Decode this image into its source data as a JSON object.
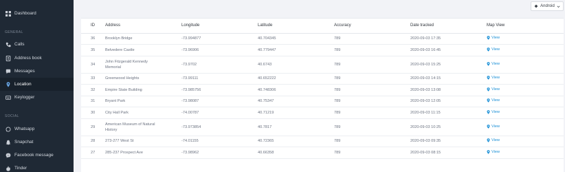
{
  "sidebar": {
    "dashboard": "Dashboard",
    "section_general": "GENERAL",
    "items": [
      {
        "label": "Calls",
        "icon": "phone-icon"
      },
      {
        "label": "Address book",
        "icon": "address-book-icon"
      },
      {
        "label": "Messages",
        "icon": "messages-icon"
      },
      {
        "label": "Location",
        "icon": "location-pin-icon"
      },
      {
        "label": "Keylogger",
        "icon": "keyboard-icon"
      }
    ],
    "section_social": "SOCIAL",
    "social_items": [
      {
        "label": "Whatsapp",
        "icon": "whatsapp-icon"
      },
      {
        "label": "Snapchat",
        "icon": "snapchat-icon"
      },
      {
        "label": "Facebook message",
        "icon": "facebook-messenger-icon"
      },
      {
        "label": "Tinder",
        "icon": "tinder-icon"
      }
    ],
    "active": "Location"
  },
  "topbar": {
    "os_label": "Android"
  },
  "table": {
    "headers": {
      "id": "ID",
      "address": "Address",
      "longitude": "Longitude",
      "latitude": "Latitude",
      "accuracy": "Accuracy",
      "date": "Date tracked",
      "map": "Map View"
    },
    "view_label": "View",
    "rows": [
      {
        "id": "36",
        "address": "Brooklyn Bridge",
        "longitude": "-73.994877",
        "latitude": "40.704345",
        "accuracy": "789",
        "date": "2020-09-03 17:35"
      },
      {
        "id": "35",
        "address": "Belvedere Castle",
        "longitude": "-73.96906",
        "latitude": "40.779447",
        "accuracy": "789",
        "date": "2020-09-03 16:45"
      },
      {
        "id": "34",
        "address": "John Fitzgerald Kennedy Memorial",
        "longitude": "-73.9702",
        "latitude": "40.6743",
        "accuracy": "789",
        "date": "2020-09-03 15:25"
      },
      {
        "id": "33",
        "address": "Greenwood Heights",
        "longitude": "-73.99111",
        "latitude": "40.652222",
        "accuracy": "789",
        "date": "2020-09-03 14:15"
      },
      {
        "id": "32",
        "address": "Empire State Building",
        "longitude": "-73.985756",
        "latitude": "40.748306",
        "accuracy": "789",
        "date": "2020-09-03 13:08"
      },
      {
        "id": "31",
        "address": "Bryant Park",
        "longitude": "-73.98087",
        "latitude": "40.75347",
        "accuracy": "789",
        "date": "2020-09-03 12:05"
      },
      {
        "id": "30",
        "address": "City Hall Park",
        "longitude": "-74.00787",
        "latitude": "40.71219",
        "accuracy": "789",
        "date": "2020-09-03 11:15"
      },
      {
        "id": "29",
        "address": "American Museum of Natural History",
        "longitude": "-73.973854",
        "latitude": "40.7817",
        "accuracy": "789",
        "date": "2020-09-03 10:25"
      },
      {
        "id": "28",
        "address": "273-277 West St",
        "longitude": "-74.01155",
        "latitude": "40.72365",
        "accuracy": "789",
        "date": "2020-09-03 09:35"
      },
      {
        "id": "27",
        "address": "285-237 Prospect Ave",
        "longitude": "-73.98962",
        "latitude": "40.66358",
        "accuracy": "789",
        "date": "2020-09-03 08:15"
      }
    ]
  },
  "colors": {
    "sidebar_bg": "#1f2935",
    "link": "#1a8fd6",
    "page_bg": "#f2f3f7"
  }
}
